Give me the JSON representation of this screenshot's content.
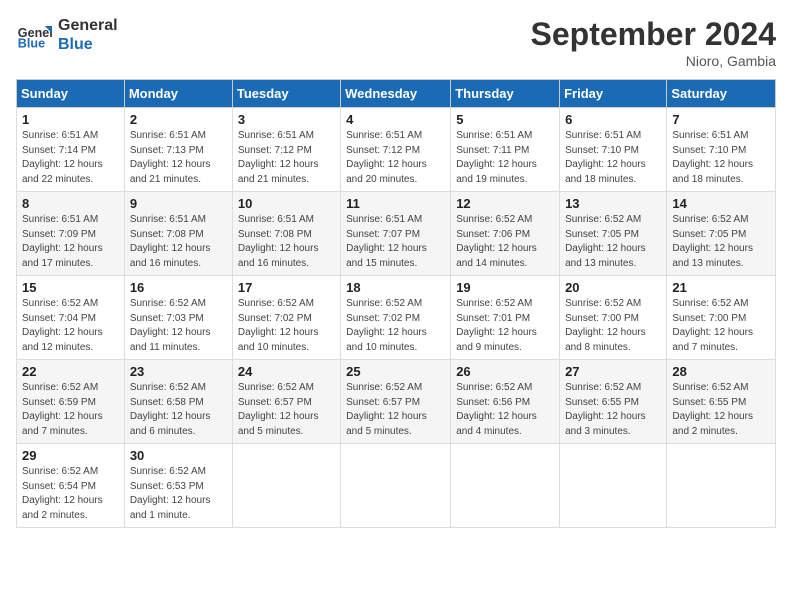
{
  "header": {
    "logo_line1": "General",
    "logo_line2": "Blue",
    "month": "September 2024",
    "location": "Nioro, Gambia"
  },
  "weekdays": [
    "Sunday",
    "Monday",
    "Tuesday",
    "Wednesday",
    "Thursday",
    "Friday",
    "Saturday"
  ],
  "weeks": [
    [
      {
        "day": "1",
        "info": "Sunrise: 6:51 AM\nSunset: 7:14 PM\nDaylight: 12 hours\nand 22 minutes."
      },
      {
        "day": "2",
        "info": "Sunrise: 6:51 AM\nSunset: 7:13 PM\nDaylight: 12 hours\nand 21 minutes."
      },
      {
        "day": "3",
        "info": "Sunrise: 6:51 AM\nSunset: 7:12 PM\nDaylight: 12 hours\nand 21 minutes."
      },
      {
        "day": "4",
        "info": "Sunrise: 6:51 AM\nSunset: 7:12 PM\nDaylight: 12 hours\nand 20 minutes."
      },
      {
        "day": "5",
        "info": "Sunrise: 6:51 AM\nSunset: 7:11 PM\nDaylight: 12 hours\nand 19 minutes."
      },
      {
        "day": "6",
        "info": "Sunrise: 6:51 AM\nSunset: 7:10 PM\nDaylight: 12 hours\nand 18 minutes."
      },
      {
        "day": "7",
        "info": "Sunrise: 6:51 AM\nSunset: 7:10 PM\nDaylight: 12 hours\nand 18 minutes."
      }
    ],
    [
      {
        "day": "8",
        "info": "Sunrise: 6:51 AM\nSunset: 7:09 PM\nDaylight: 12 hours\nand 17 minutes."
      },
      {
        "day": "9",
        "info": "Sunrise: 6:51 AM\nSunset: 7:08 PM\nDaylight: 12 hours\nand 16 minutes."
      },
      {
        "day": "10",
        "info": "Sunrise: 6:51 AM\nSunset: 7:08 PM\nDaylight: 12 hours\nand 16 minutes."
      },
      {
        "day": "11",
        "info": "Sunrise: 6:51 AM\nSunset: 7:07 PM\nDaylight: 12 hours\nand 15 minutes."
      },
      {
        "day": "12",
        "info": "Sunrise: 6:52 AM\nSunset: 7:06 PM\nDaylight: 12 hours\nand 14 minutes."
      },
      {
        "day": "13",
        "info": "Sunrise: 6:52 AM\nSunset: 7:05 PM\nDaylight: 12 hours\nand 13 minutes."
      },
      {
        "day": "14",
        "info": "Sunrise: 6:52 AM\nSunset: 7:05 PM\nDaylight: 12 hours\nand 13 minutes."
      }
    ],
    [
      {
        "day": "15",
        "info": "Sunrise: 6:52 AM\nSunset: 7:04 PM\nDaylight: 12 hours\nand 12 minutes."
      },
      {
        "day": "16",
        "info": "Sunrise: 6:52 AM\nSunset: 7:03 PM\nDaylight: 12 hours\nand 11 minutes."
      },
      {
        "day": "17",
        "info": "Sunrise: 6:52 AM\nSunset: 7:02 PM\nDaylight: 12 hours\nand 10 minutes."
      },
      {
        "day": "18",
        "info": "Sunrise: 6:52 AM\nSunset: 7:02 PM\nDaylight: 12 hours\nand 10 minutes."
      },
      {
        "day": "19",
        "info": "Sunrise: 6:52 AM\nSunset: 7:01 PM\nDaylight: 12 hours\nand 9 minutes."
      },
      {
        "day": "20",
        "info": "Sunrise: 6:52 AM\nSunset: 7:00 PM\nDaylight: 12 hours\nand 8 minutes."
      },
      {
        "day": "21",
        "info": "Sunrise: 6:52 AM\nSunset: 7:00 PM\nDaylight: 12 hours\nand 7 minutes."
      }
    ],
    [
      {
        "day": "22",
        "info": "Sunrise: 6:52 AM\nSunset: 6:59 PM\nDaylight: 12 hours\nand 7 minutes."
      },
      {
        "day": "23",
        "info": "Sunrise: 6:52 AM\nSunset: 6:58 PM\nDaylight: 12 hours\nand 6 minutes."
      },
      {
        "day": "24",
        "info": "Sunrise: 6:52 AM\nSunset: 6:57 PM\nDaylight: 12 hours\nand 5 minutes."
      },
      {
        "day": "25",
        "info": "Sunrise: 6:52 AM\nSunset: 6:57 PM\nDaylight: 12 hours\nand 5 minutes."
      },
      {
        "day": "26",
        "info": "Sunrise: 6:52 AM\nSunset: 6:56 PM\nDaylight: 12 hours\nand 4 minutes."
      },
      {
        "day": "27",
        "info": "Sunrise: 6:52 AM\nSunset: 6:55 PM\nDaylight: 12 hours\nand 3 minutes."
      },
      {
        "day": "28",
        "info": "Sunrise: 6:52 AM\nSunset: 6:55 PM\nDaylight: 12 hours\nand 2 minutes."
      }
    ],
    [
      {
        "day": "29",
        "info": "Sunrise: 6:52 AM\nSunset: 6:54 PM\nDaylight: 12 hours\nand 2 minutes."
      },
      {
        "day": "30",
        "info": "Sunrise: 6:52 AM\nSunset: 6:53 PM\nDaylight: 12 hours\nand 1 minute."
      },
      {
        "day": "",
        "info": ""
      },
      {
        "day": "",
        "info": ""
      },
      {
        "day": "",
        "info": ""
      },
      {
        "day": "",
        "info": ""
      },
      {
        "day": "",
        "info": ""
      }
    ]
  ]
}
